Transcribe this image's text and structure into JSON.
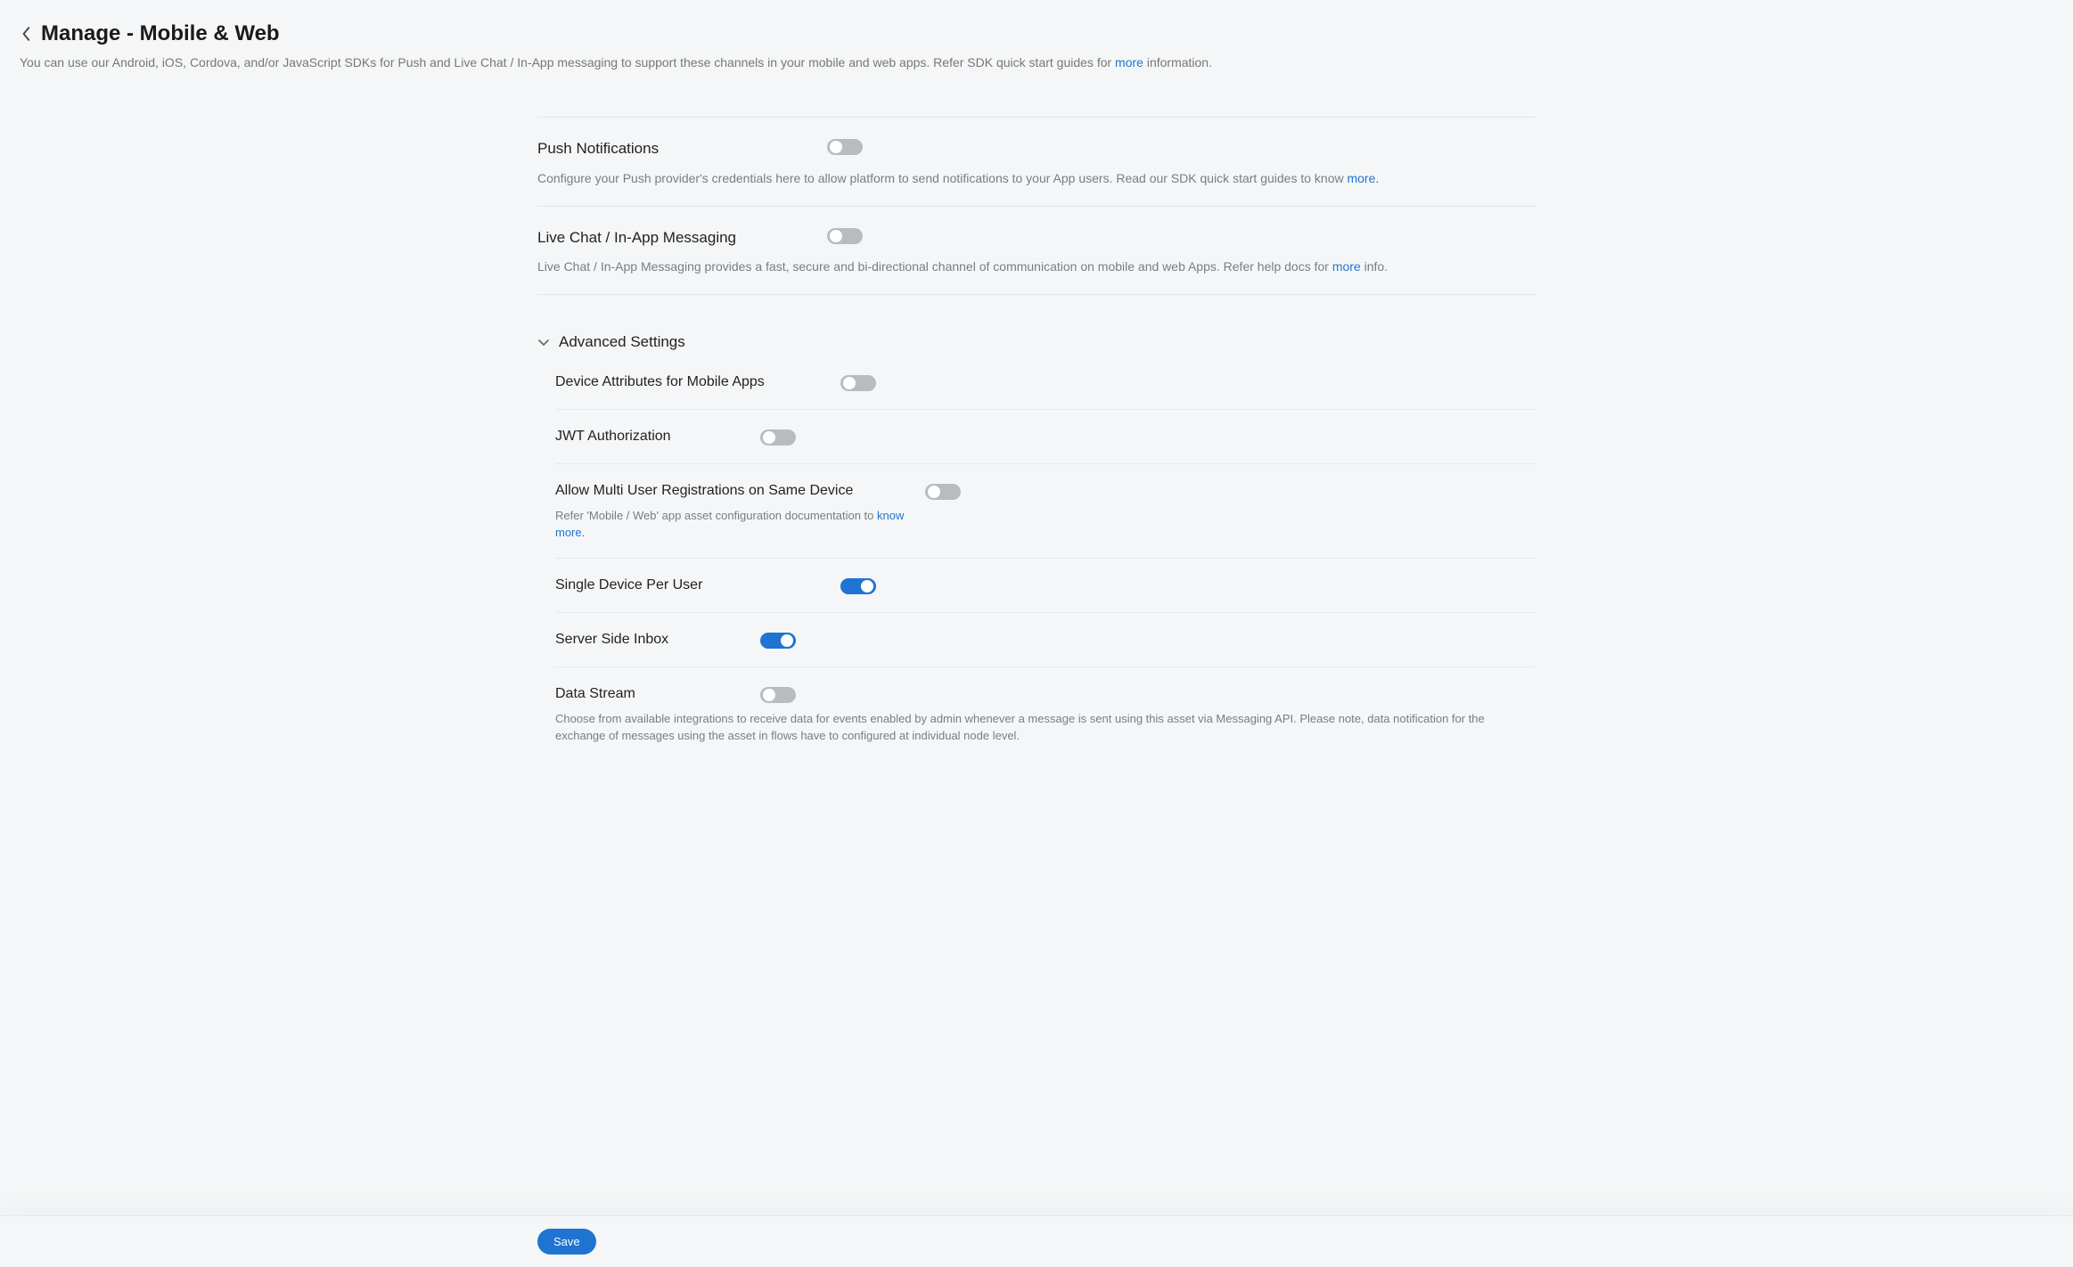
{
  "header": {
    "title": "Manage - Mobile & Web",
    "subtitle_pre": "You can use our Android, iOS, Cordova, and/or JavaScript SDKs for Push and Live Chat / In-App messaging to support these channels in your mobile and web apps. Refer SDK quick start guides for ",
    "subtitle_link": "more",
    "subtitle_post": " information."
  },
  "push": {
    "title": "Push Notifications",
    "desc_pre": "Configure your Push provider's credentials here to allow platform to send notifications to your App users. Read our SDK quick start guides to know ",
    "desc_link": "more.",
    "on": false
  },
  "livechat": {
    "title": "Live Chat / In-App Messaging",
    "desc_pre": "Live Chat / In-App Messaging provides a fast, secure and bi-directional channel of communication on mobile and web Apps. Refer help docs for ",
    "desc_link": "more",
    "desc_post": " info.",
    "on": false
  },
  "advanced": {
    "title": "Advanced Settings",
    "device_attrs": {
      "label": "Device Attributes for Mobile Apps",
      "on": false
    },
    "jwt": {
      "label": "JWT Authorization",
      "on": false
    },
    "multi_user": {
      "label": "Allow Multi User Registrations on Same Device",
      "desc_pre": "Refer 'Mobile / Web' app asset configuration documentation to ",
      "desc_link": "know more.",
      "on": false
    },
    "single_device": {
      "label": "Single Device Per User",
      "on": true
    },
    "server_inbox": {
      "label": "Server Side Inbox",
      "on": true
    },
    "data_stream": {
      "label": "Data Stream",
      "desc": "Choose from available integrations to receive data for events enabled by admin whenever a message is sent using this asset via Messaging API. Please note, data notification for the exchange of messages using the asset in flows have to configured at individual node level.",
      "on": false
    }
  },
  "footer": {
    "save": "Save"
  },
  "colors": {
    "link": "#1f74d1",
    "toggle_on": "#1f74d1",
    "toggle_off": "#b8bcc0"
  }
}
